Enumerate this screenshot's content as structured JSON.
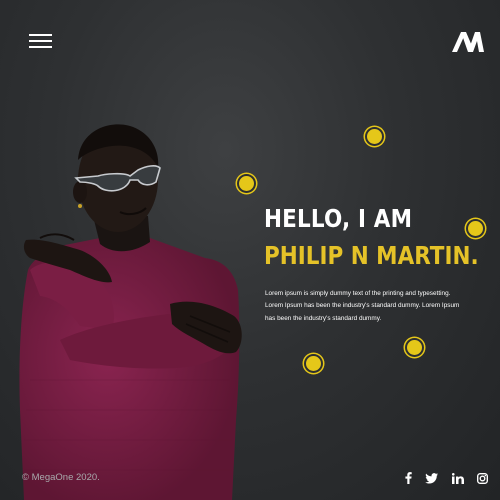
{
  "header": {
    "menu_icon": "hamburger-menu-icon",
    "logo_icon": "megaone-logo-icon"
  },
  "hero": {
    "greeting": "HELLO, I AM",
    "name": "PHILIP N MARTIN.",
    "description_lines": [
      "Lorem ipsum is simply dummy text of the printing and typesetting.",
      "Lorem Ipsum has been the industry's standard dummy.  Lorem Ipsum",
      "has been the industry's standard dummy."
    ]
  },
  "footer": {
    "copyright": "© MegaOne 2020.",
    "social": [
      "facebook-icon",
      "twitter-icon",
      "linkedin-icon",
      "instagram-icon"
    ]
  },
  "colors": {
    "background": "#2d2f31",
    "accent": "#e5c228",
    "sweater": "#7d1f45"
  }
}
